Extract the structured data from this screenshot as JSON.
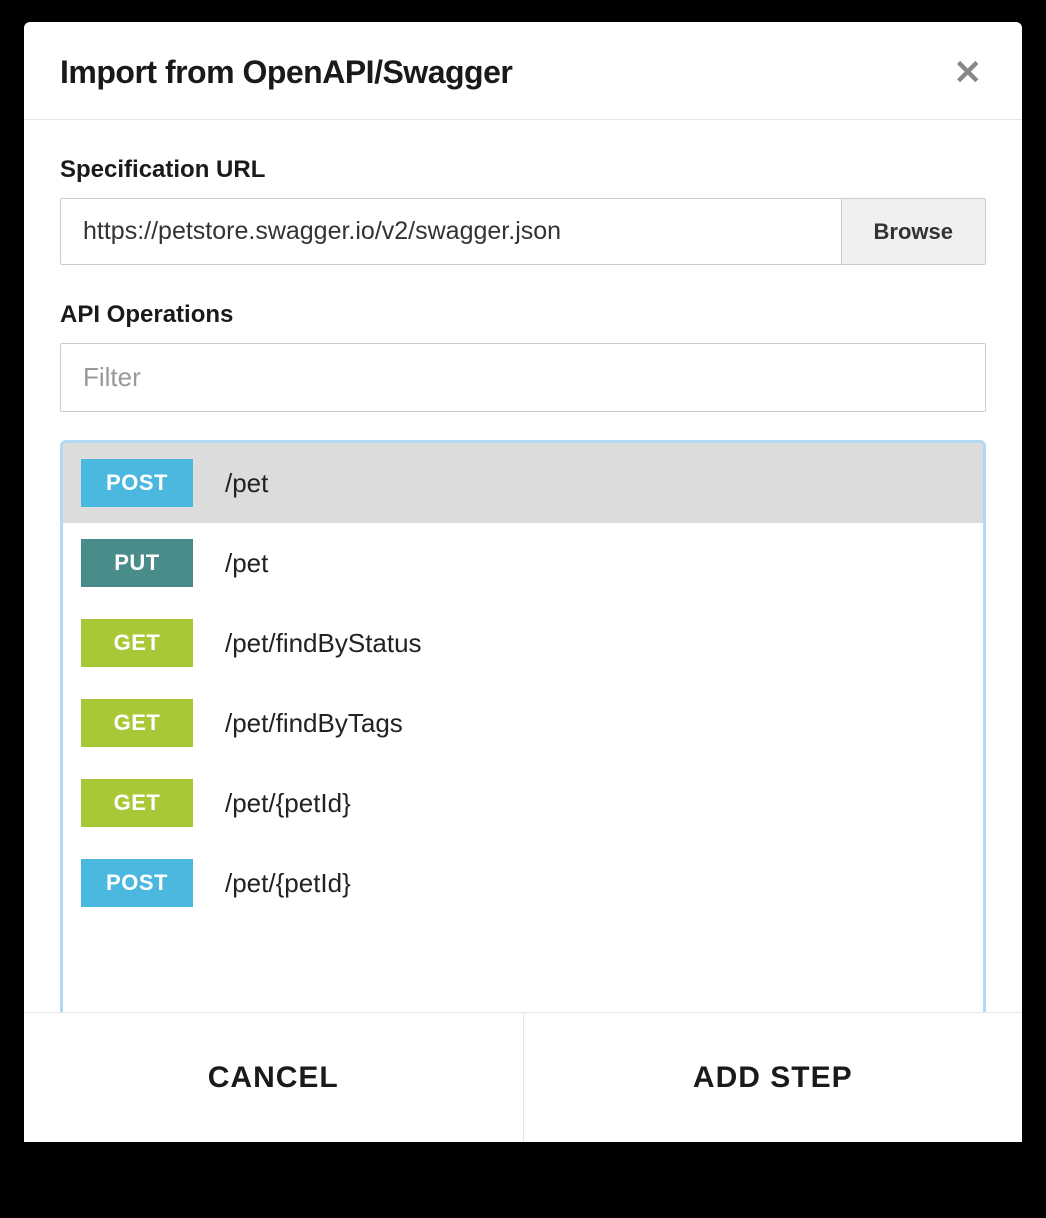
{
  "modal": {
    "title": "Import from OpenAPI/Swagger",
    "spec_url_label": "Specification URL",
    "spec_url_value": "https://petstore.swagger.io/v2/swagger.json",
    "browse_label": "Browse",
    "api_operations_label": "API Operations",
    "filter_placeholder": "Filter",
    "operations": [
      {
        "method": "POST",
        "method_class": "method-post",
        "path": "/pet",
        "selected": true
      },
      {
        "method": "PUT",
        "method_class": "method-put",
        "path": "/pet",
        "selected": false
      },
      {
        "method": "GET",
        "method_class": "method-get",
        "path": "/pet/findByStatus",
        "selected": false
      },
      {
        "method": "GET",
        "method_class": "method-get",
        "path": "/pet/findByTags",
        "selected": false
      },
      {
        "method": "GET",
        "method_class": "method-get",
        "path": "/pet/{petId}",
        "selected": false
      },
      {
        "method": "POST",
        "method_class": "method-post",
        "path": "/pet/{petId}",
        "selected": false
      }
    ],
    "cancel_label": "CANCEL",
    "add_step_label": "ADD STEP"
  }
}
